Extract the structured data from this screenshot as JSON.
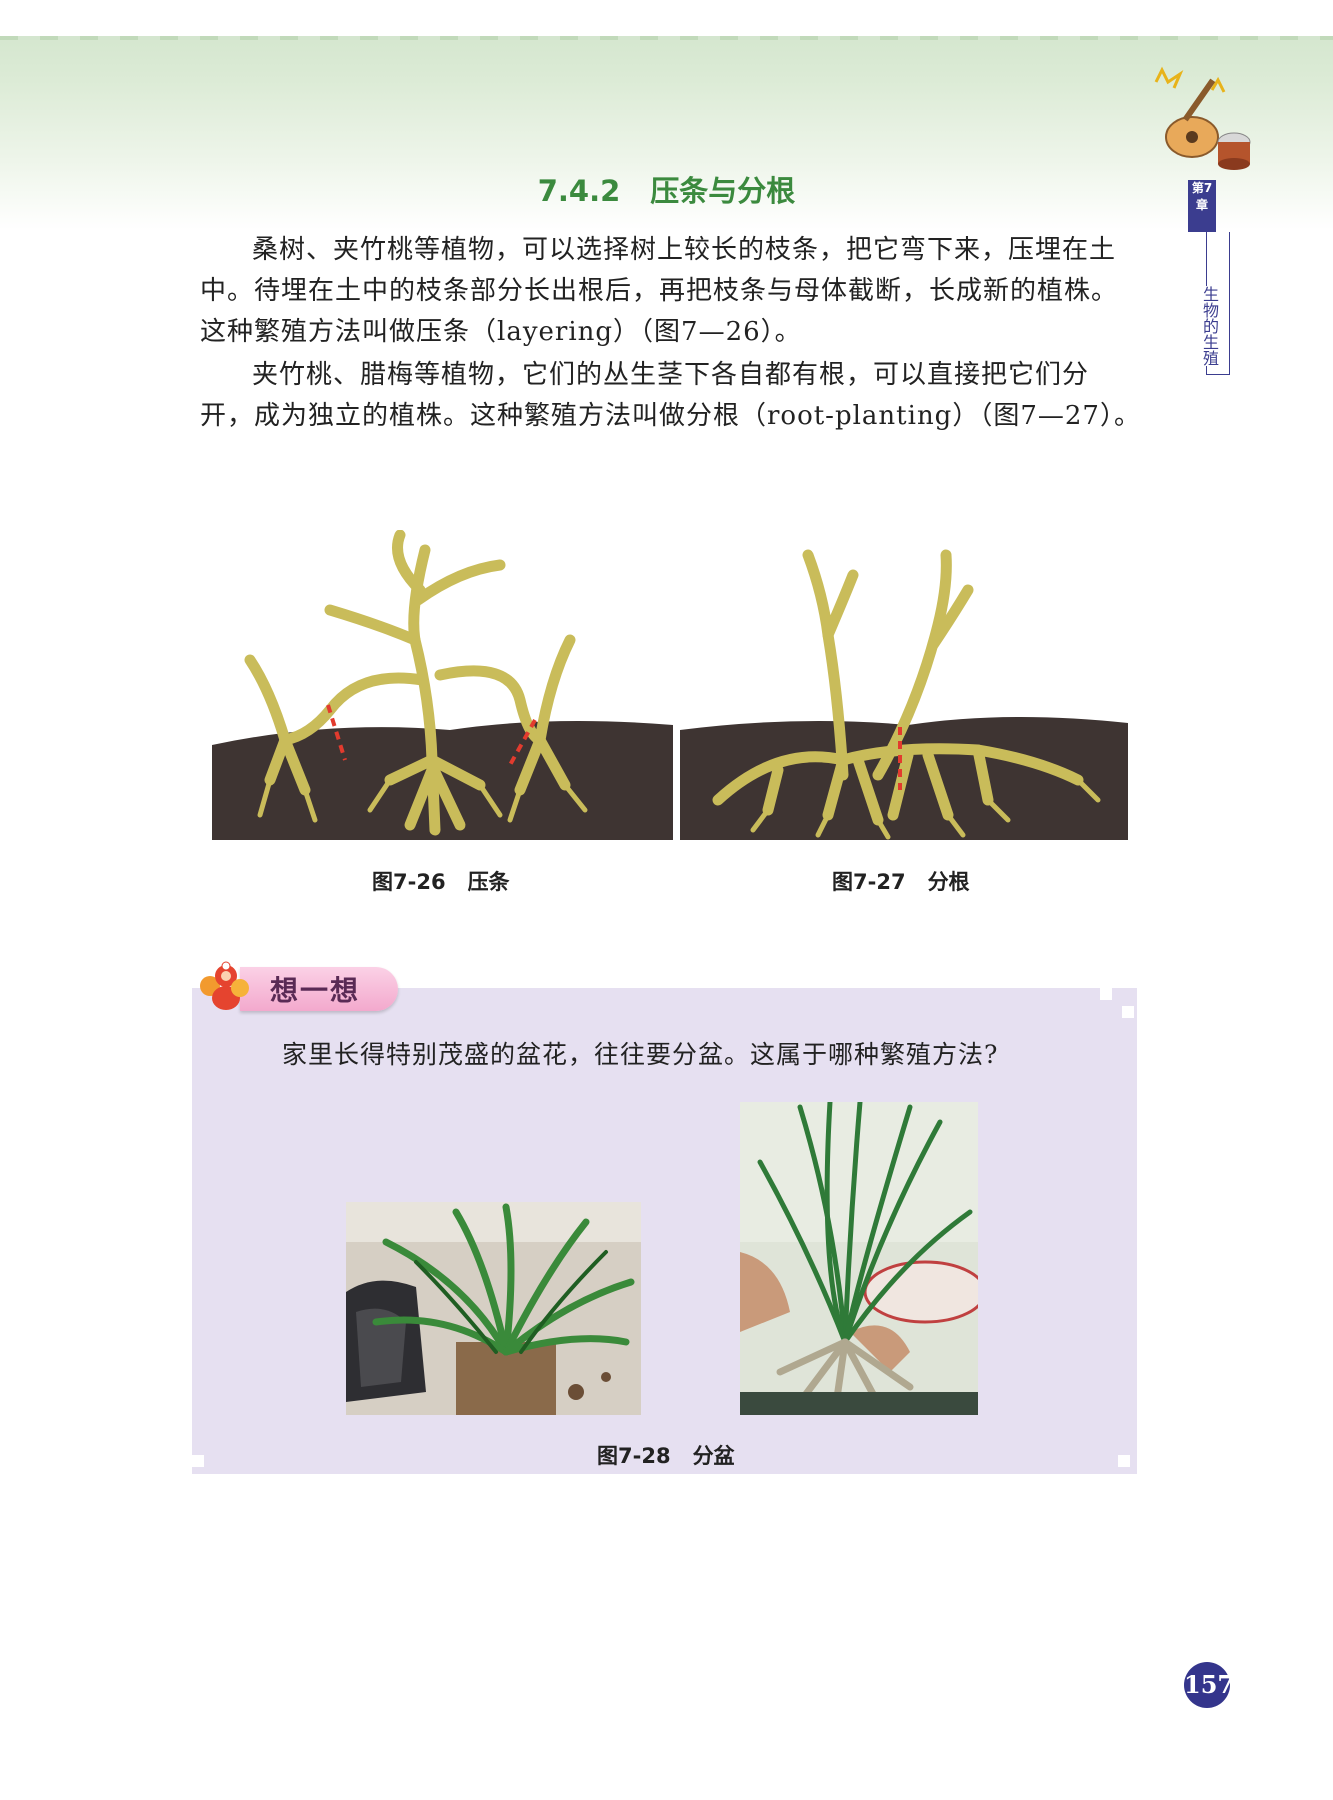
{
  "section": {
    "number": "7.4.2",
    "title": "压条与分根"
  },
  "paragraphs": [
    "桑树、夹竹桃等植物，可以选择树上较长的枝条，把它弯下来，压埋在土中。待埋在土中的枝条部分长出根后，再把枝条与母体截断，长成新的植株。这种繁殖方法叫做压条（layering）（图7—26）。",
    "夹竹桃、腊梅等植物，它们的丛生茎下各自都有根，可以直接把它们分开，成为独立的植株。这种繁殖方法叫做分根（root-planting）（图7—27）。"
  ],
  "side_tab": {
    "chapter": "第7章",
    "title": "生物的生殖"
  },
  "figures": {
    "fig726": {
      "label": "图7-26",
      "title": "压条"
    },
    "fig727": {
      "label": "图7-27",
      "title": "分根"
    },
    "fig728": {
      "label": "图7-28",
      "title": "分盆"
    }
  },
  "think": {
    "title": "想一想",
    "question": "家里长得特别茂盛的盆花，往往要分盆。这属于哪种繁殖方法?"
  },
  "page_number": "157",
  "colors": {
    "section_title": "#3b8a3e",
    "soil": "#3e3432",
    "root": "#c9bc5a",
    "cut_mark": "#e23b2e",
    "think_bg": "#e6e0f1",
    "think_header": "#f3a9cd",
    "chapter_tab": "#3b3d8f",
    "page_badge": "#34358c"
  }
}
